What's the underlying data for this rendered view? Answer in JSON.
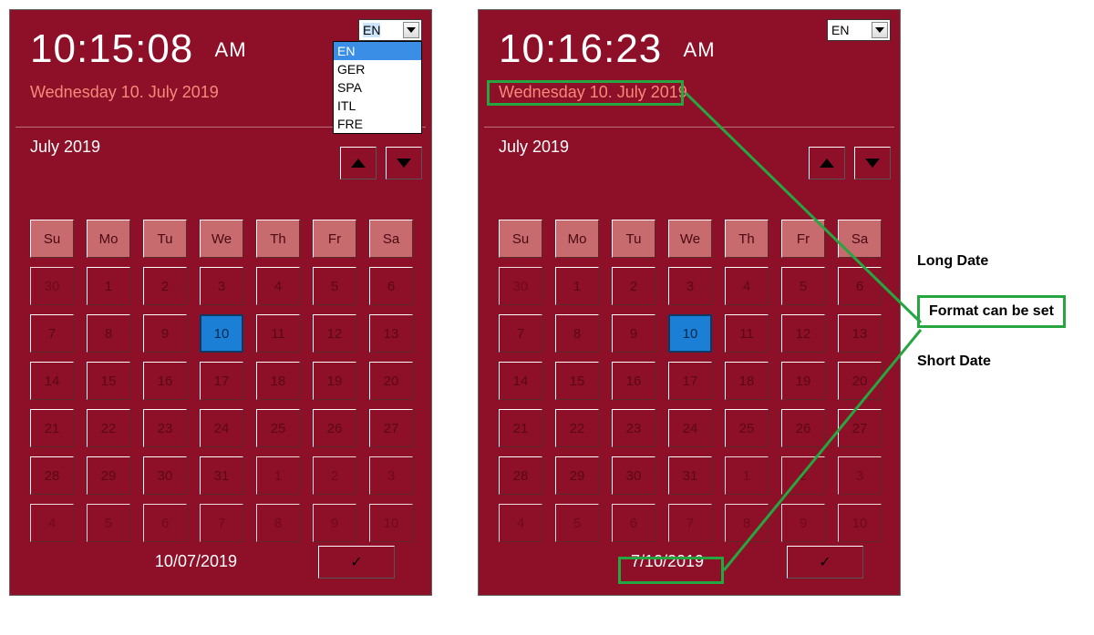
{
  "panels": [
    {
      "time": "10:15:08",
      "ampm": "AM",
      "datestr": "Wednesday 10. July 2019",
      "month": "July 2019",
      "lang_selected": "EN",
      "dropdown_open": true,
      "footer_date": "10/07/2019"
    },
    {
      "time": "10:16:23",
      "ampm": "AM",
      "datestr": "Wednesday 10. July 2019",
      "month": "July 2019",
      "lang_selected": "EN",
      "dropdown_open": false,
      "footer_date": "7/10/2019"
    }
  ],
  "lang_options": [
    "EN",
    "GER",
    "SPA",
    "ITL",
    "FRE"
  ],
  "day_headers": [
    "Su",
    "Mo",
    "Tu",
    "We",
    "Th",
    "Fr",
    "Sa"
  ],
  "calendar": {
    "rows": [
      [
        {
          "n": "30",
          "out": true
        },
        {
          "n": "1"
        },
        {
          "n": "2"
        },
        {
          "n": "3"
        },
        {
          "n": "4"
        },
        {
          "n": "5"
        },
        {
          "n": "6"
        }
      ],
      [
        {
          "n": "7"
        },
        {
          "n": "8"
        },
        {
          "n": "9"
        },
        {
          "n": "10",
          "today": true
        },
        {
          "n": "11"
        },
        {
          "n": "12"
        },
        {
          "n": "13"
        }
      ],
      [
        {
          "n": "14"
        },
        {
          "n": "15"
        },
        {
          "n": "16"
        },
        {
          "n": "17"
        },
        {
          "n": "18"
        },
        {
          "n": "19"
        },
        {
          "n": "20"
        }
      ],
      [
        {
          "n": "21"
        },
        {
          "n": "22"
        },
        {
          "n": "23"
        },
        {
          "n": "24"
        },
        {
          "n": "25"
        },
        {
          "n": "26"
        },
        {
          "n": "27"
        }
      ],
      [
        {
          "n": "28"
        },
        {
          "n": "29"
        },
        {
          "n": "30"
        },
        {
          "n": "31"
        },
        {
          "n": "1",
          "out": true
        },
        {
          "n": "2",
          "out": true
        },
        {
          "n": "3",
          "out": true
        }
      ],
      [
        {
          "n": "4",
          "out": true
        },
        {
          "n": "5",
          "out": true
        },
        {
          "n": "6",
          "out": true
        },
        {
          "n": "7",
          "out": true
        },
        {
          "n": "8",
          "out": true
        },
        {
          "n": "9",
          "out": true
        },
        {
          "n": "10",
          "out": true
        }
      ]
    ]
  },
  "annotations": {
    "long": "Long Date",
    "box": "Format can be set",
    "short": "Short Date"
  }
}
